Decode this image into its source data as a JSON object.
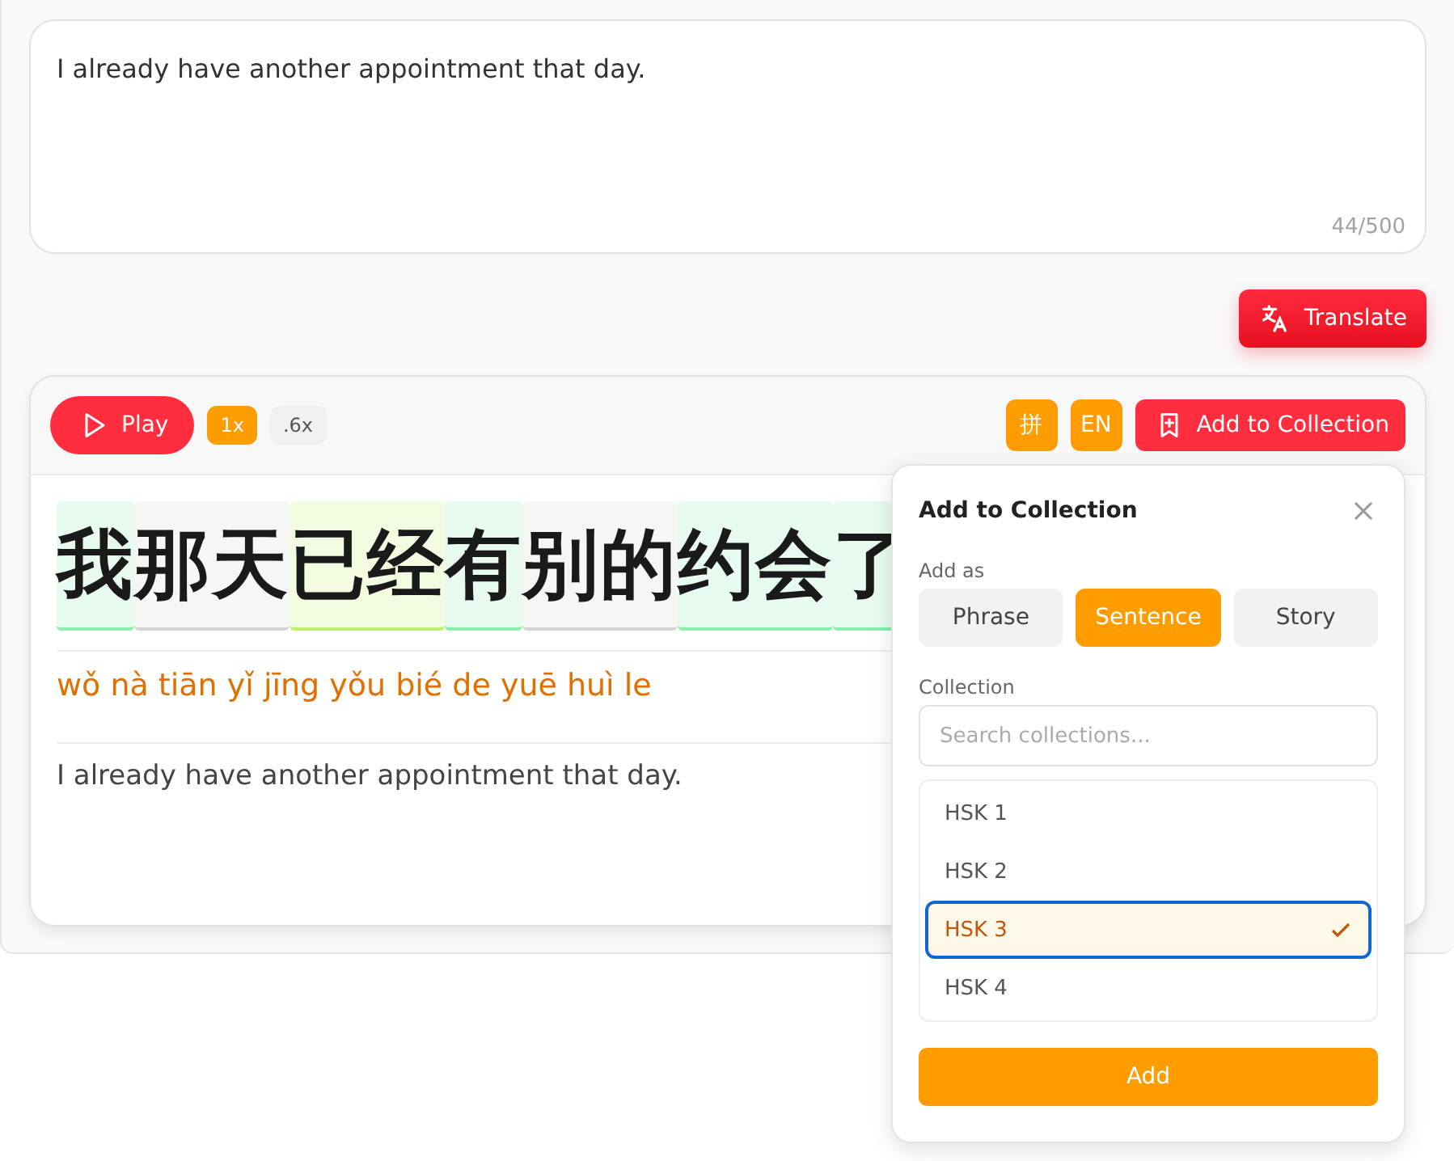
{
  "input": {
    "value": "I already have another appointment that day.",
    "counter": "44/500"
  },
  "translate_button": "Translate",
  "player": {
    "play": "Play",
    "speeds": [
      {
        "label": "1x",
        "selected": true
      },
      {
        "label": ".6x",
        "selected": false
      }
    ],
    "toggles": [
      {
        "label": "拼",
        "on": true
      },
      {
        "label": "EN",
        "on": true
      }
    ],
    "add_button": "Add to Collection"
  },
  "result": {
    "words": [
      {
        "text": "我",
        "color": "#86efac"
      },
      {
        "text": "那天",
        "color": "#d4d4d4"
      },
      {
        "text": "已经",
        "color": "#bef264"
      },
      {
        "text": "有",
        "color": "#86efac"
      },
      {
        "text": "别的",
        "color": "#d4d4d4"
      },
      {
        "text": "约会",
        "color": "#86efac"
      },
      {
        "text": "了",
        "color": "#86efac"
      }
    ],
    "pinyin": "wǒ nà tiān yǐ jīng yǒu bié de yuē huì le",
    "translation": "I already have another appointment that day."
  },
  "popup": {
    "title": "Add to Collection",
    "add_as_label": "Add as",
    "types": [
      {
        "label": "Phrase",
        "selected": false
      },
      {
        "label": "Sentence",
        "selected": true
      },
      {
        "label": "Story",
        "selected": false
      }
    ],
    "collection_label": "Collection",
    "search": {
      "placeholder": "Search collections..."
    },
    "collections": [
      {
        "label": "HSK 1",
        "selected": false
      },
      {
        "label": "HSK 2",
        "selected": false
      },
      {
        "label": "HSK 3",
        "selected": true
      },
      {
        "label": "HSK 4",
        "selected": false
      }
    ],
    "add": "Add"
  }
}
